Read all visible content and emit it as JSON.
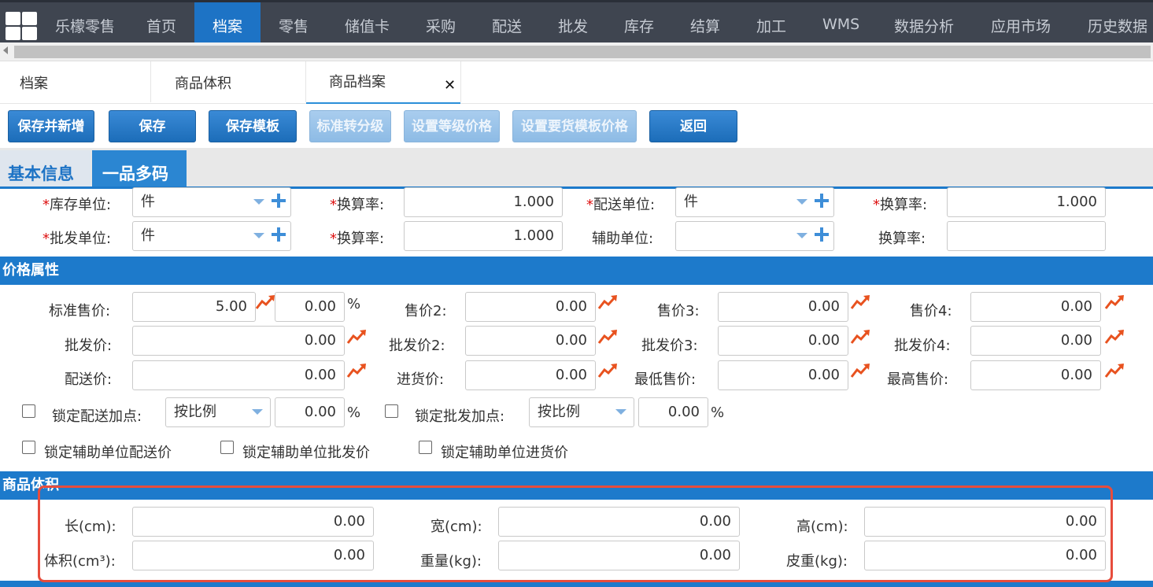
{
  "nav": {
    "app_name": "乐檬零售",
    "items": [
      "首页",
      "档案",
      "零售",
      "储值卡",
      "采购",
      "配送",
      "批发",
      "库存",
      "结算",
      "加工",
      "WMS",
      "数据分析",
      "应用市场",
      "历史数据"
    ],
    "active_index": 1
  },
  "tabs": [
    "档案",
    "商品体积",
    "商品档案"
  ],
  "toolbar": {
    "buttons": [
      "保存并新增",
      "保存",
      "保存模板",
      "标准转分级",
      "设置等级价格",
      "设置要货模板价格",
      "返回"
    ]
  },
  "subtabs": [
    "基本信息",
    "一品多码"
  ],
  "units": {
    "stock_unit_label": "库存单位:",
    "stock_unit_value": "件",
    "rate1_label": "换算率:",
    "rate1_value": "1.000",
    "dist_unit_label": "配送单位:",
    "dist_unit_value": "件",
    "rate2_label": "换算率:",
    "rate2_value": "1.000",
    "wholesale_unit_label": "批发单位:",
    "wholesale_unit_value": "件",
    "rate3_label": "换算率:",
    "rate3_value": "1.000",
    "aux_unit_label": "辅助单位:",
    "aux_unit_value": "",
    "rate4_label": "换算率:",
    "rate4_value": ""
  },
  "price": {
    "section_title": "价格属性",
    "std_price_label": "标准售价:",
    "std_price_value": "5.00",
    "std_pct_value": "0.00",
    "pct_sign": "%",
    "price2_label": "售价2:",
    "price2_value": "0.00",
    "price3_label": "售价3:",
    "price3_value": "0.00",
    "price4_label": "售价4:",
    "price4_value": "0.00",
    "wholesale_label": "批发价:",
    "wholesale_value": "0.00",
    "wholesale2_label": "批发价2:",
    "wholesale2_value": "0.00",
    "wholesale3_label": "批发价3:",
    "wholesale3_value": "0.00",
    "wholesale4_label": "批发价4:",
    "wholesale4_value": "0.00",
    "dist_label": "配送价:",
    "dist_value": "0.00",
    "purchase_label": "进货价:",
    "purchase_value": "0.00",
    "min_label": "最低售价:",
    "min_value": "0.00",
    "max_label": "最高售价:",
    "max_value": "0.00",
    "lock_dist_label": "锁定配送加点:",
    "lock_dist_mode": "按比例",
    "lock_dist_value": "0.00",
    "lock_wholesale_label": "锁定批发加点:",
    "lock_wholesale_mode": "按比例",
    "lock_wholesale_value": "0.00",
    "lock_aux_dist_label": "锁定辅助单位配送价",
    "lock_aux_wholesale_label": "锁定辅助单位批发价",
    "lock_aux_purchase_label": "锁定辅助单位进货价"
  },
  "volume": {
    "section_title": "商品体积",
    "length_label": "长(cm):",
    "length_value": "0.00",
    "width_label": "宽(cm):",
    "width_value": "0.00",
    "height_label": "高(cm):",
    "height_value": "0.00",
    "volume_label": "体积(cm³):",
    "volume_value": "0.00",
    "weight_label": "重量(kg):",
    "weight_value": "0.00",
    "tare_label": "皮重(kg):",
    "tare_value": "0.00"
  },
  "colors": {
    "nav_bg": "#3f4550",
    "accent": "#1d7acb",
    "highlight": "#e74c3c"
  }
}
